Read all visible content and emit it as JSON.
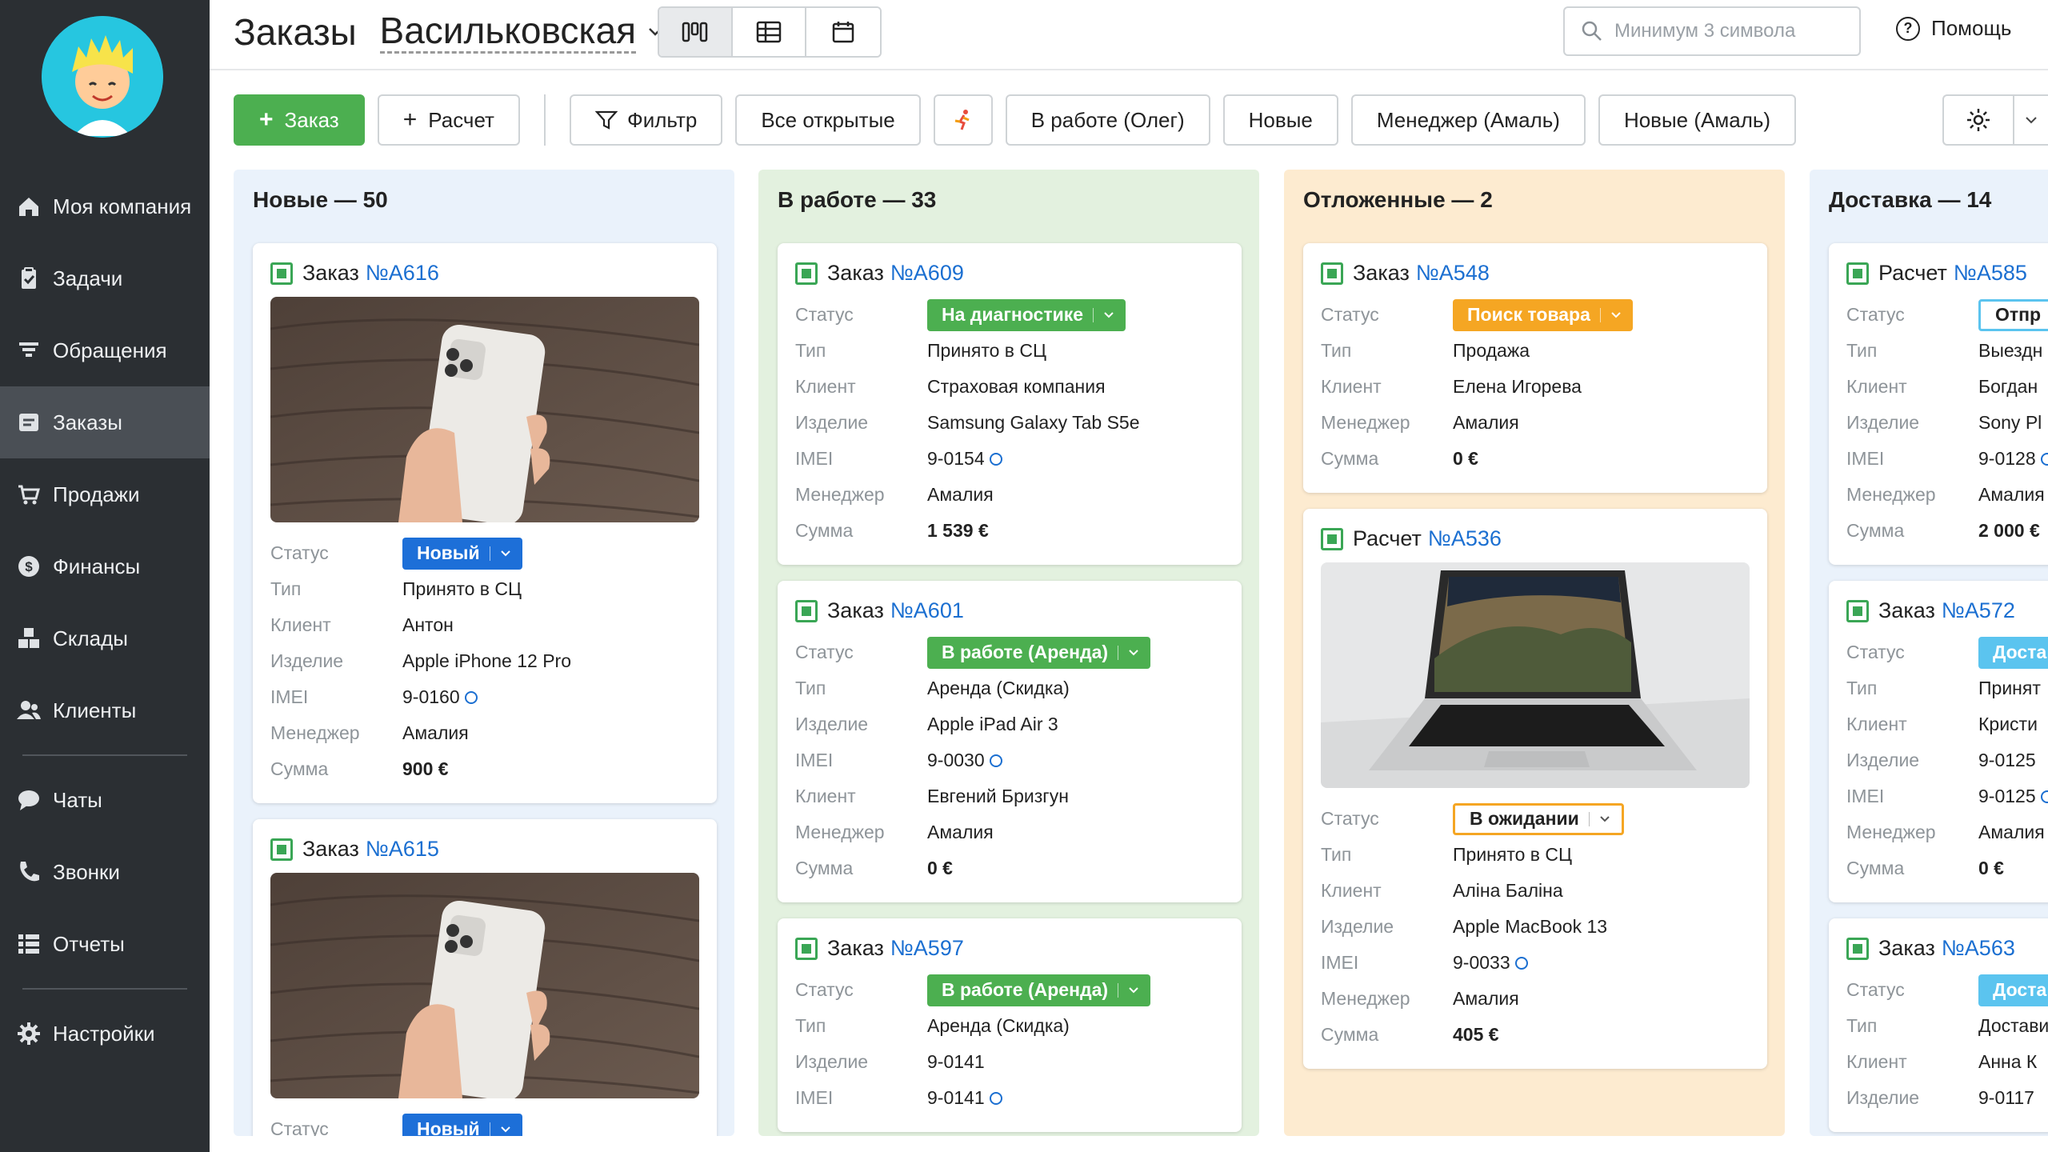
{
  "sidebar": {
    "items": [
      {
        "label": "Моя компания",
        "icon": "home-icon"
      },
      {
        "label": "Задачи",
        "icon": "clipboard-icon"
      },
      {
        "label": "Обращения",
        "icon": "funnel-icon"
      },
      {
        "label": "Заказы",
        "icon": "orders-icon"
      },
      {
        "label": "Продажи",
        "icon": "cart-icon"
      },
      {
        "label": "Финансы",
        "icon": "dollar-icon"
      },
      {
        "label": "Склады",
        "icon": "boxes-icon"
      },
      {
        "label": "Клиенты",
        "icon": "users-icon"
      },
      {
        "label": "Чаты",
        "icon": "chat-icon"
      },
      {
        "label": "Звонки",
        "icon": "phone-icon"
      },
      {
        "label": "Отчеты",
        "icon": "reports-icon"
      },
      {
        "label": "Настройки",
        "icon": "gear-icon"
      }
    ],
    "active": "Заказы"
  },
  "header": {
    "title": "Заказы",
    "location": "Васильковская",
    "search_placeholder": "Минимум 3 символа",
    "help_label": "Помощь"
  },
  "toolbar": {
    "add_order": "Заказ",
    "add_estimate": "Расчет",
    "filter": "Фильтр",
    "presets": [
      "Все открытые",
      "В работе (Олег)",
      "Новые",
      "Менеджер (Амаль)",
      "Новые (Амаль)"
    ]
  },
  "labels": {
    "status": "Статус",
    "type": "Тип",
    "client": "Клиент",
    "product": "Изделие",
    "imei": "IMEI",
    "manager": "Менеджер",
    "sum": "Сумма"
  },
  "columns": [
    {
      "title": "Новые — 50",
      "color": "#eaf2fb",
      "cards": [
        {
          "kind": "Заказ",
          "num": "№A616",
          "photo": "iphone",
          "status": "Новый",
          "status_style": "blue",
          "rows": [
            [
              "Тип",
              "Принято в СЦ"
            ],
            [
              "Клиент",
              "Антон"
            ],
            [
              "Изделие",
              "Apple iPhone 12 Pro"
            ],
            [
              "IMEI",
              "9-0160"
            ],
            [
              "Менеджер",
              "Амалия"
            ],
            [
              "Сумма",
              "900 €"
            ]
          ]
        },
        {
          "kind": "Заказ",
          "num": "№A615",
          "photo": "iphone",
          "status": "Новый",
          "status_style": "blue",
          "rows": []
        }
      ]
    },
    {
      "title": "В работе — 33",
      "color": "#e3f1df",
      "cards": [
        {
          "kind": "Заказ",
          "num": "№A609",
          "status": "На диагностике",
          "status_style": "green",
          "rows": [
            [
              "Тип",
              "Принято в СЦ"
            ],
            [
              "Клиент",
              "Страховая компания"
            ],
            [
              "Изделие",
              "Samsung Galaxy Tab S5e"
            ],
            [
              "IMEI",
              "9-0154"
            ],
            [
              "Менеджер",
              "Амалия"
            ],
            [
              "Сумма",
              "1 539 €"
            ]
          ]
        },
        {
          "kind": "Заказ",
          "num": "№A601",
          "status": "В работе (Аренда)",
          "status_style": "green",
          "rows": [
            [
              "Тип",
              "Аренда (Скидка)"
            ],
            [
              "Изделие",
              "Apple iPad Air 3"
            ],
            [
              "IMEI",
              "9-0030"
            ],
            [
              "Клиент",
              "Евгений Бризгун"
            ],
            [
              "Менеджер",
              "Амалия"
            ],
            [
              "Сумма",
              "0 €"
            ]
          ]
        },
        {
          "kind": "Заказ",
          "num": "№A597",
          "status": "В работе (Аренда)",
          "status_style": "green",
          "rows": [
            [
              "Тип",
              "Аренда (Скидка)"
            ],
            [
              "Изделие",
              "9-0141"
            ],
            [
              "IMEI",
              "9-0141"
            ]
          ]
        }
      ]
    },
    {
      "title": "Отложенные — 2",
      "color": "#fdebd0",
      "cards": [
        {
          "kind": "Заказ",
          "num": "№A548",
          "status": "Поиск товара",
          "status_style": "orange",
          "rows": [
            [
              "Тип",
              "Продажа"
            ],
            [
              "Клиент",
              "Елена Игорева"
            ],
            [
              "Менеджер",
              "Амалия"
            ],
            [
              "Сумма",
              "0 €"
            ]
          ]
        },
        {
          "kind": "Расчет",
          "num": "№A536",
          "photo": "macbook",
          "status": "В ожидании",
          "status_style": "outline",
          "rows": [
            [
              "Тип",
              "Принято в СЦ"
            ],
            [
              "Клиент",
              "Аліна Баліна"
            ],
            [
              "Изделие",
              "Apple MacBook 13"
            ],
            [
              "IMEI",
              "9-0033"
            ],
            [
              "Менеджер",
              "Амалия"
            ],
            [
              "Сумма",
              "405 €"
            ]
          ]
        }
      ]
    },
    {
      "title": "Доставка — 14",
      "color": "#eaf2fb",
      "cards": [
        {
          "kind": "Расчет",
          "num": "№A585",
          "status": "Отпр",
          "status_style": "white",
          "rows": [
            [
              "Тип",
              "Выездн"
            ],
            [
              "Клиент",
              "Богдан"
            ],
            [
              "Изделие",
              "Sony Pl"
            ],
            [
              "IMEI",
              "9-0128"
            ],
            [
              "Менеджер",
              "Амалия"
            ],
            [
              "Сумма",
              "2 000 €"
            ]
          ]
        },
        {
          "kind": "Заказ",
          "num": "№A572",
          "status": "Доста",
          "status_style": "cyan",
          "rows": [
            [
              "Тип",
              "Принят"
            ],
            [
              "Клиент",
              "Кристи"
            ],
            [
              "Изделие",
              "9-0125"
            ],
            [
              "IMEI",
              "9-0125"
            ],
            [
              "Менеджер",
              "Амалия"
            ],
            [
              "Сумма",
              "0 €"
            ]
          ]
        },
        {
          "kind": "Заказ",
          "num": "№A563",
          "status": "Доста",
          "status_style": "cyan",
          "rows": [
            [
              "Тип",
              "Достави"
            ],
            [
              "Клиент",
              "Анна К"
            ],
            [
              "Изделие",
              "9-0117"
            ]
          ]
        }
      ]
    }
  ]
}
